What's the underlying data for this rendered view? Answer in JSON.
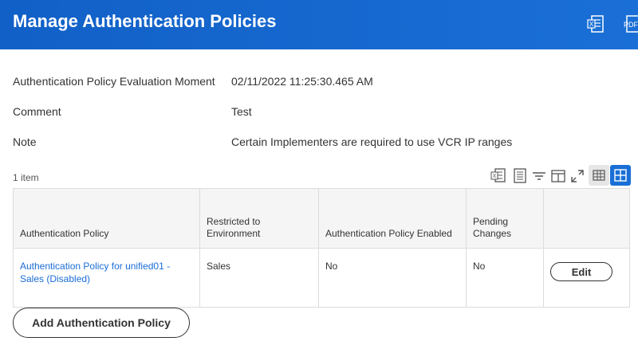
{
  "header": {
    "title": "Manage Authentication Policies",
    "excel_icon": "excel-export-icon",
    "pdf_icon": "pdf-export-icon",
    "pdf_icon_text": "PDF",
    "background_color": "#1a6fd6"
  },
  "fields": [
    {
      "label": "Authentication Policy Evaluation Moment",
      "value": "02/11/2022 11:25:30.465 AM"
    },
    {
      "label": "Comment",
      "value": "Test"
    },
    {
      "label": "Note",
      "value": "Certain Implementers are required to use VCR IP ranges"
    }
  ],
  "grid": {
    "item_count": "1 item",
    "tools": [
      "excel-export-icon",
      "print-icon",
      "filter-icon",
      "columns-icon",
      "fullscreen-icon",
      "table-view-icon",
      "grid-view-icon"
    ],
    "columns": [
      "Authentication Policy",
      "Restricted to Environment",
      "Authentication Policy Enabled",
      "Pending Changes",
      ""
    ],
    "rows": [
      {
        "policy": "Authentication Policy for unified01 - Sales (Disabled)",
        "environment": "Sales",
        "enabled": "No",
        "pending": "No",
        "action": "Edit"
      }
    ]
  },
  "actions": {
    "add_label": "Add Authentication Policy"
  },
  "colors": {
    "link": "#1a6dd6",
    "active_toggle": "#1a6fd6"
  }
}
